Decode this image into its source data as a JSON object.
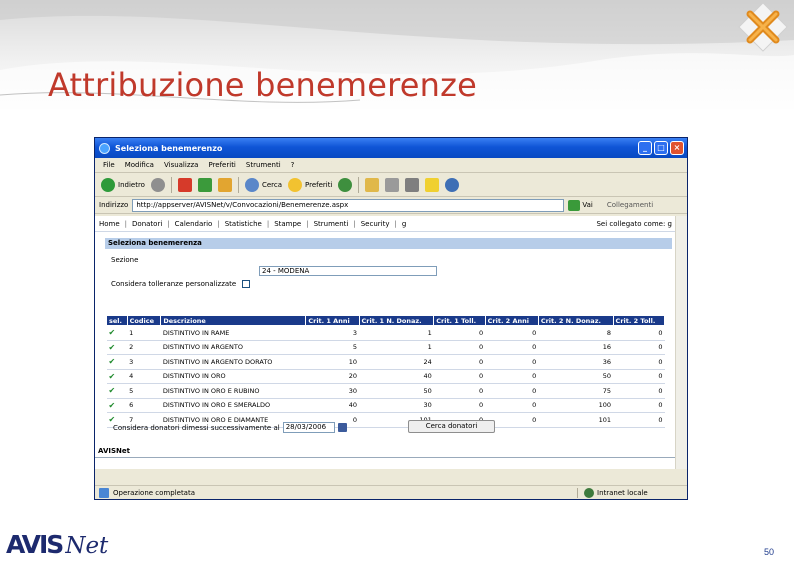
{
  "slide": {
    "title": "Attribuzione benemerenze",
    "page_number": "50",
    "logo_text_left": "AVIS",
    "logo_text_right": "Net"
  },
  "window": {
    "title": "Seleziona benemerenzo",
    "menu": [
      "File",
      "Modifica",
      "Visualizza",
      "Preferiti",
      "Strumenti",
      "?"
    ],
    "toolbar": {
      "back_label": "Indietro",
      "search_label": "Cerca",
      "favorites_label": "Preferiti"
    },
    "address": {
      "label": "Indirizzo",
      "url": "http://appserver/AVISNet/v/Convocazioni/Benemerenze.aspx",
      "go_label": "Vai",
      "links_label": "Collegamenti"
    },
    "status": {
      "left": "Operazione completata",
      "right": "Intranet locale"
    }
  },
  "page": {
    "nav": [
      "Home",
      "Donatori",
      "Calendario",
      "Statistiche",
      "Stampe",
      "Strumenti",
      "Security",
      "g"
    ],
    "connected_label": "Sei collegato come: g",
    "section_title": "Seleziona benemerenza",
    "sezione_label": "Sezione",
    "sezione_value": "24 - MODENA",
    "tolleranze_label": "Considera tolleranze personalizzate",
    "table": {
      "headers": [
        "sel.",
        "Codice",
        "Descrizione",
        "Crit. 1 Anni",
        "Crit. 1 N. Donaz.",
        "Crit. 1 Toll.",
        "Crit. 2 Anni",
        "Crit. 2 N. Donaz.",
        "Crit. 2 Toll."
      ],
      "rows": [
        [
          "1",
          "DISTINTIVO IN RAME",
          "3",
          "1",
          "0",
          "0",
          "8",
          "0"
        ],
        [
          "2",
          "DISTINTIVO IN ARGENTO",
          "5",
          "1",
          "0",
          "0",
          "16",
          "0"
        ],
        [
          "3",
          "DISTINTIVO IN ARGENTO DORATO",
          "10",
          "24",
          "0",
          "0",
          "36",
          "0"
        ],
        [
          "4",
          "DISTINTIVO IN ORO",
          "20",
          "40",
          "0",
          "0",
          "50",
          "0"
        ],
        [
          "5",
          "DISTINTIVO IN ORO E RUBINO",
          "30",
          "50",
          "0",
          "0",
          "75",
          "0"
        ],
        [
          "6",
          "DISTINTIVO IN ORO E SMERALDO",
          "40",
          "30",
          "0",
          "0",
          "100",
          "0"
        ],
        [
          "7",
          "DISTINTIVO IN ORO E DIAMANTE",
          "0",
          "101",
          "0",
          "0",
          "101",
          "0"
        ]
      ]
    },
    "dimessi_label": "Considera donatori dimessi successivamente al",
    "dimessi_date": "28/03/2006",
    "search_button": "Cerca donatori",
    "footer_brand": "AVISNet"
  }
}
